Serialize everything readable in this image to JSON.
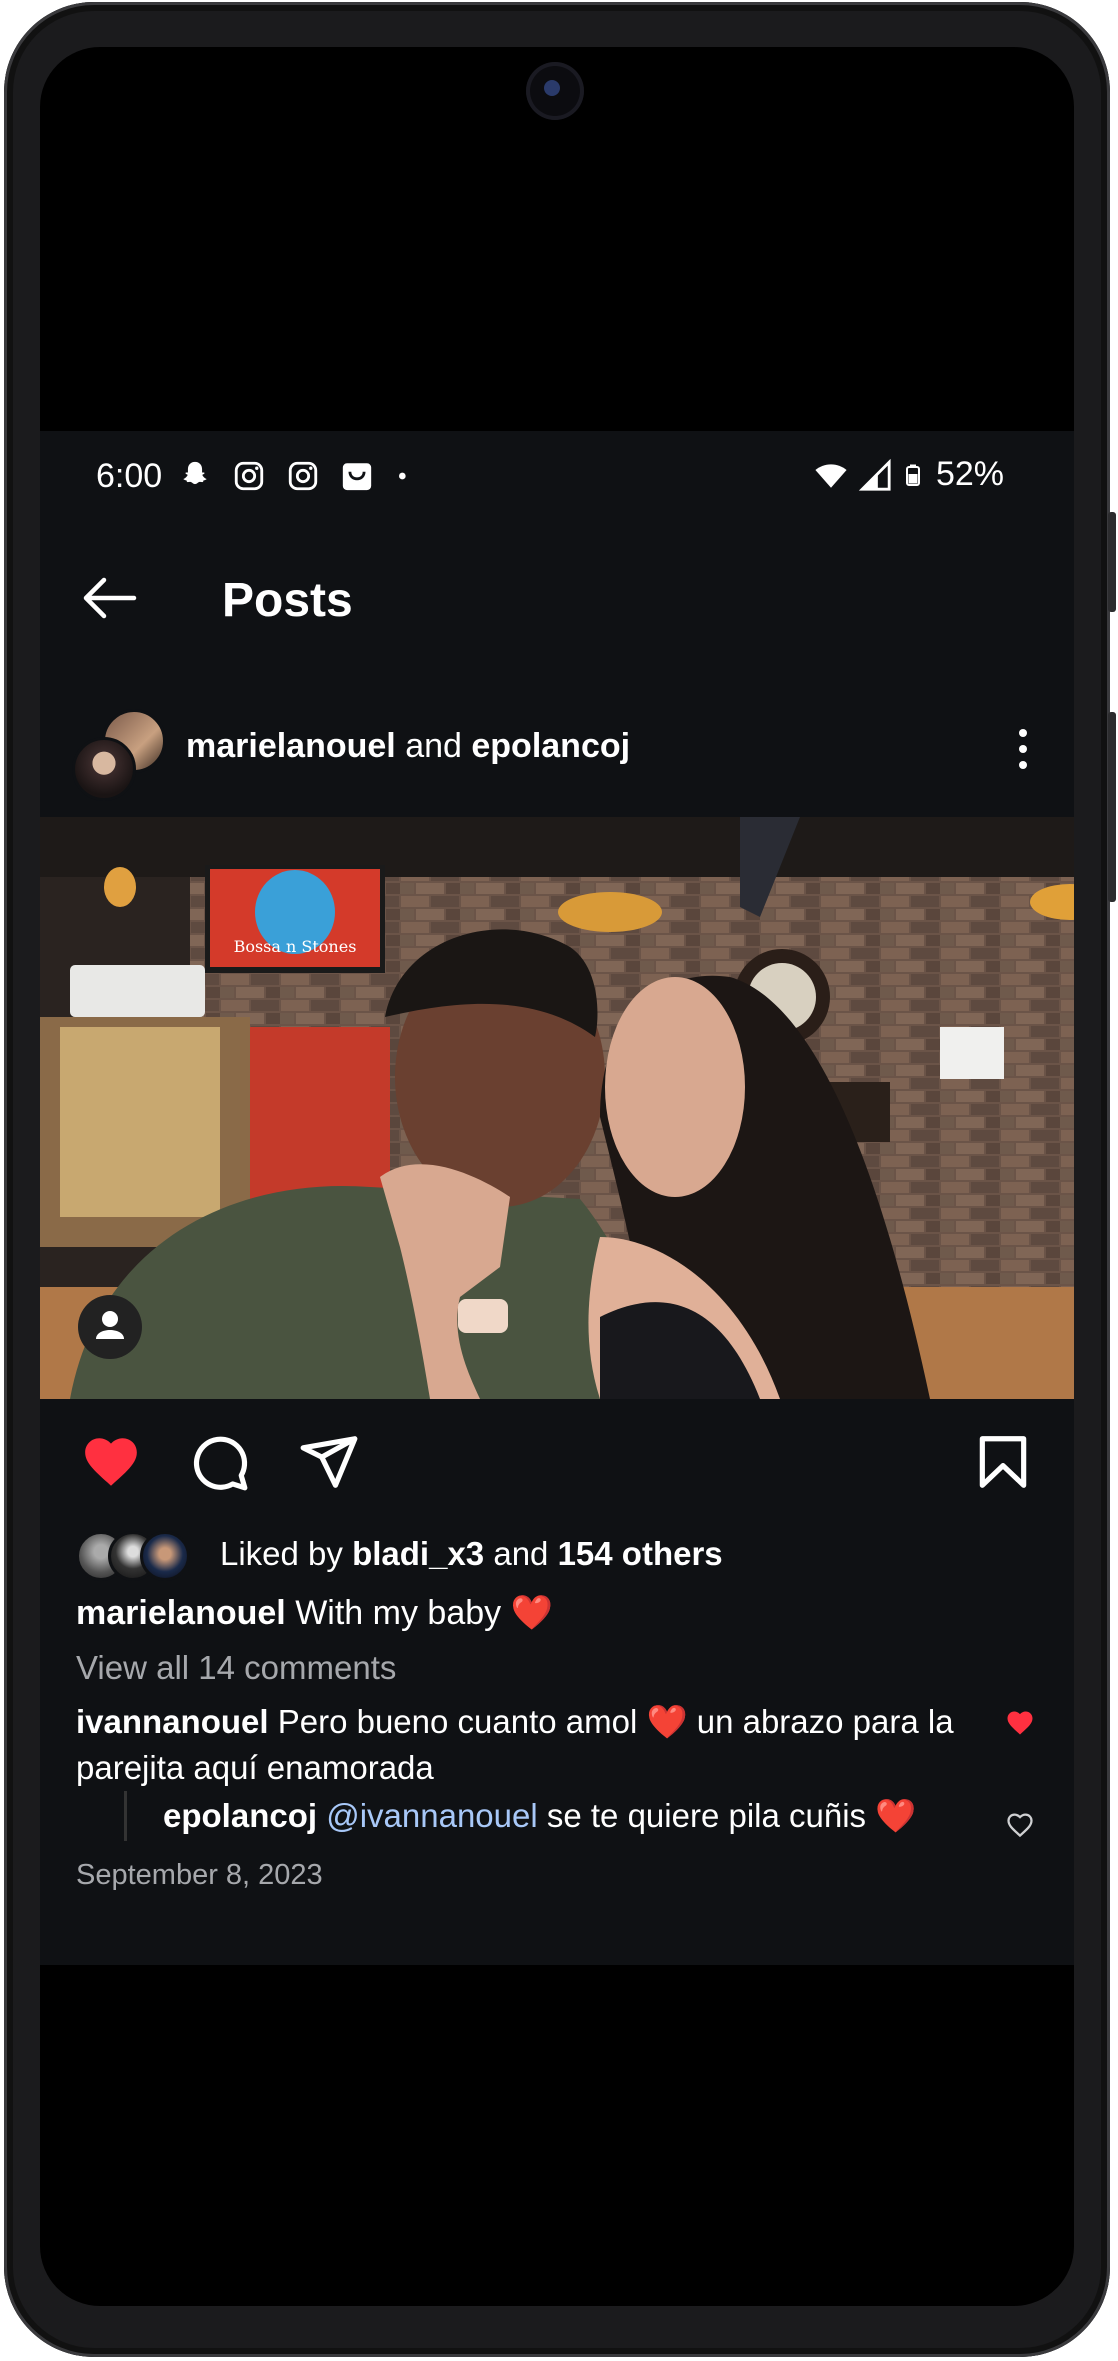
{
  "status_bar": {
    "time": "6:00",
    "battery": "52%",
    "left_icons": [
      "snapchat-icon",
      "instagram-icon",
      "instagram-icon",
      "shopping-bag-icon",
      "dot-icon"
    ],
    "right_icons": [
      "wifi-icon",
      "cell-signal-icon",
      "battery-icon"
    ]
  },
  "header": {
    "title": "Posts",
    "back_icon": "arrow-left-icon"
  },
  "post": {
    "author1": "marielanouel",
    "conjunction": " and ",
    "author2": "epolancoj",
    "menu_icon": "more-vertical-icon",
    "photo_tv_text": "Bossa n Stones",
    "actions": [
      "heart-filled-icon",
      "comment-icon",
      "send-icon",
      "bookmark-icon"
    ],
    "likes_prefix": "Liked by ",
    "likes_user": "bladi_x3",
    "likes_mid": " and ",
    "likes_count": "154 others",
    "caption_user": "marielanouel",
    "caption_text": " With my baby ❤️",
    "view_all": "View all 14 comments",
    "comments": [
      {
        "user": "ivannanouel",
        "text": " Pero bueno cuanto amol ❤️ un abrazo para la parejita aquí enamorada",
        "liked": true
      },
      {
        "user": "epolancoj",
        "mention": "@ivannanouel",
        "text": " se te quiere pila cuñis ❤️",
        "liked": false
      }
    ],
    "date": "September 8, 2023"
  },
  "colors": {
    "background": "#0f1114",
    "like_red": "#ff3040",
    "mention_blue": "#a8c8f8",
    "muted_text": "#a6a8ac"
  }
}
